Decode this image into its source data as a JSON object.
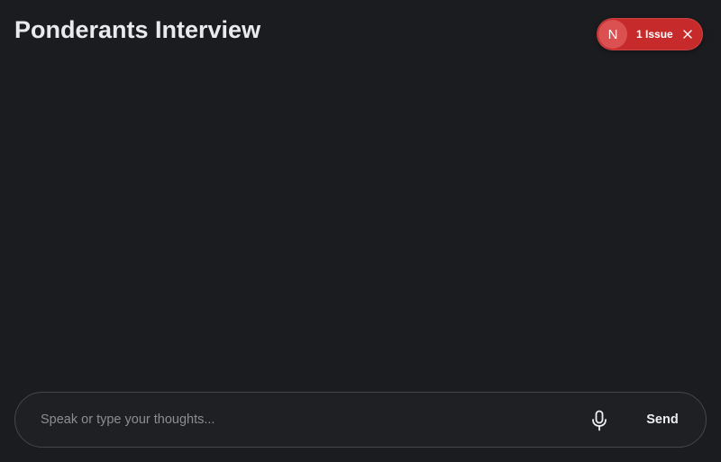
{
  "header": {
    "title": "Ponderants Interview"
  },
  "issue_badge": {
    "avatar_letter": "N",
    "label": "1 Issue",
    "close_icon": "close-icon",
    "color": "#c72a2a"
  },
  "composer": {
    "value": "",
    "placeholder": "Speak or type your thoughts...",
    "mic_icon": "microphone-icon",
    "send_label": "Send"
  },
  "theme": {
    "background": "#1b1c20",
    "border": "#45464c"
  }
}
